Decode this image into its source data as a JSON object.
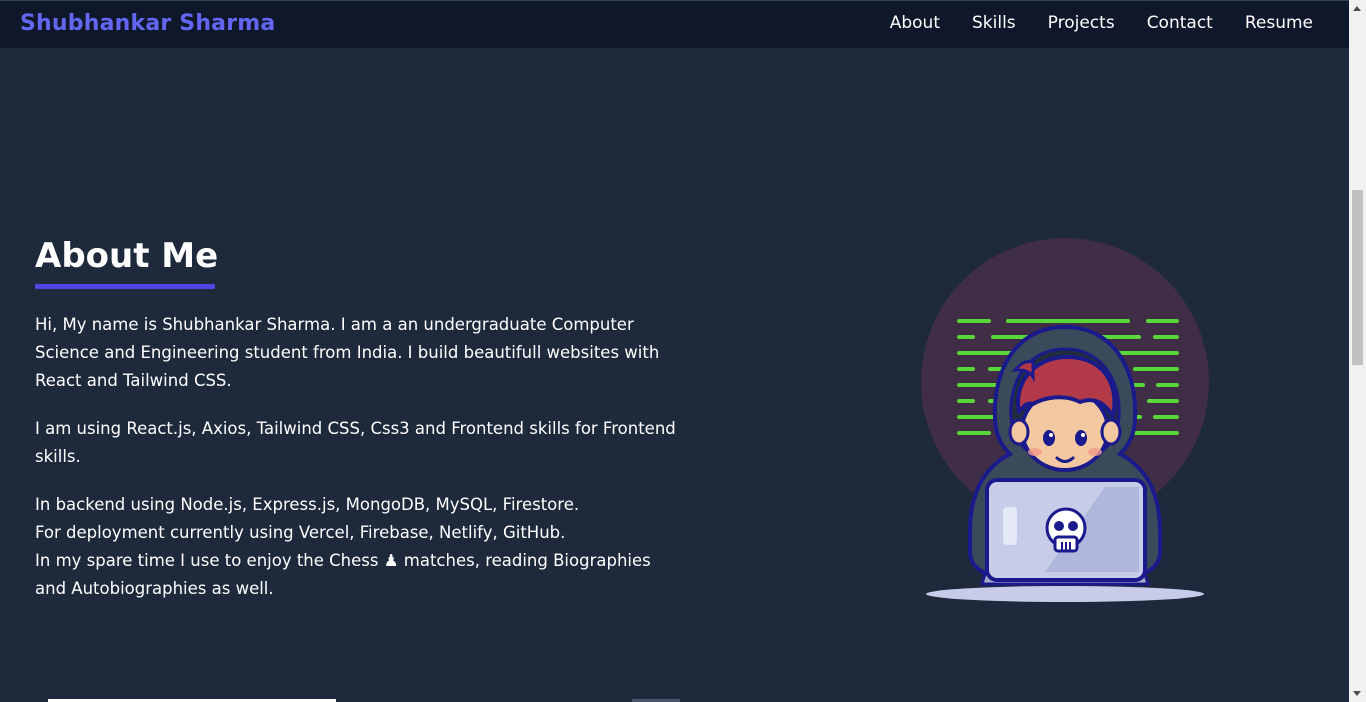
{
  "navbar": {
    "brand": "Shubhankar Sharma",
    "links": [
      {
        "label": "About"
      },
      {
        "label": "Skills"
      },
      {
        "label": "Projects"
      },
      {
        "label": "Contact"
      },
      {
        "label": "Resume"
      }
    ]
  },
  "about": {
    "title": "About Me",
    "paragraphs": [
      "Hi, My name is Shubhankar Sharma. I am a an undergraduate Computer Science and Engineering student from India. I build beautifull websites with React and Tailwind CSS.",
      "I am using React.js, Axios, Tailwind CSS, Css3 and Frontend skills for Frontend skills."
    ],
    "lines": [
      "In backend using Node.js, Express.js, MongoDB, MySQL, Firestore.",
      "For deployment currently using Vercel, Firebase, Netlify, GitHub.",
      "In my spare time I use to enjoy the Chess ♟ matches, reading Biographies and Autobiographies as well."
    ]
  },
  "illustration": {
    "icon": "hacker-with-laptop-illustration",
    "colors": {
      "circle": "#3f2e45",
      "code_lines": "#58d63a",
      "hood": "#3b4a5a",
      "hair": "#b23a48",
      "laptop": "#c7cde8",
      "outline": "#1a1a8c"
    }
  },
  "colors": {
    "background": "#1e293b",
    "navbar": "#0f172a",
    "brand": "#6366f1",
    "accent": "#4f46e5",
    "text": "#ffffff"
  }
}
